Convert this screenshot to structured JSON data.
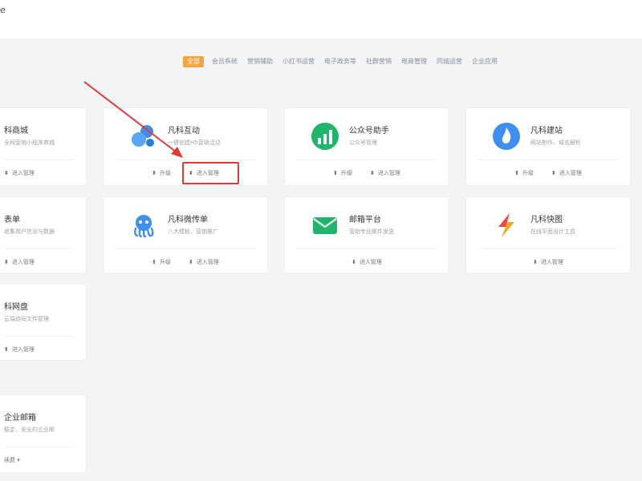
{
  "topbar": {
    "logo_fragment": "e"
  },
  "nav": {
    "items": [
      "全部",
      "会员系统",
      "营销辅助",
      "小红书运营",
      "电子政务等",
      "社群营销",
      "电商管理",
      "同城运营",
      "企业应用"
    ],
    "active_index": 0
  },
  "cards": [
    {
      "title": "科商城",
      "desc": "全网营销小程序商城",
      "actions": [
        "进入管理"
      ],
      "icon": "shop-icon"
    },
    {
      "title": "凡科互动",
      "desc": "一键创建H5营销活动",
      "actions": [
        "升级",
        "进入管理"
      ],
      "icon": "puzzle-icon",
      "highlight_action": 1
    },
    {
      "title": "公众号助手",
      "desc": "公众号管理",
      "actions": [
        "升级",
        "进入管理"
      ],
      "icon": "chart-growth-icon"
    },
    {
      "title": "凡科建站",
      "desc": "网站制作、域名解析",
      "actions": [
        "升级",
        "进入管理"
      ],
      "icon": "flame-icon"
    },
    {
      "title": "表单",
      "desc": "收集用户信息与数据",
      "actions": [
        "进入管理"
      ],
      "icon": "form-icon"
    },
    {
      "title": "凡科微传单",
      "desc": "八大模板，营销推广",
      "actions": [
        "升级",
        "进入管理"
      ],
      "icon": "octopus-icon"
    },
    {
      "title": "邮箱平台",
      "desc": "营销专业邮件发送",
      "actions": [
        "进入管理"
      ],
      "icon": "envelope-icon"
    },
    {
      "title": "凡科快图",
      "desc": "在线平面设计工具",
      "actions": [
        "进入管理"
      ],
      "icon": "lightning-icon"
    },
    {
      "title": "科网盘",
      "desc": "云端协同文件管理",
      "actions": [
        "进入管理"
      ],
      "icon": "drive-icon"
    },
    {
      "title": "企业邮箱",
      "desc": "稳定、安全的企业邮",
      "actions": [
        "续费 ▾"
      ],
      "icon": "mail-icon"
    }
  ],
  "action_glyphs": {
    "升级": "⬆",
    "进入管理": "⬍",
    "续费 ▾": ""
  },
  "colors": {
    "accent": "#f6a341",
    "highlight": "#e53935",
    "icon_blue": "#3f8ef0",
    "icon_green": "#1fb56b",
    "icon_orange": "#f5a623"
  }
}
